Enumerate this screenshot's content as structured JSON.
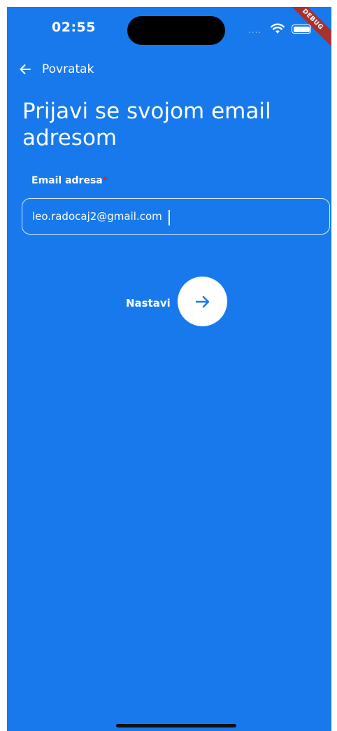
{
  "status_bar": {
    "time": "02:55",
    "signal": "....",
    "debug_banner": "DEBUG"
  },
  "header": {
    "back_label": "Povratak"
  },
  "main": {
    "title": "Prijavi se svojom email adresom",
    "email_label": "Email adresa",
    "required_mark": "*",
    "email_value": "leo.radocaj2@gmail.com",
    "continue_label": "Nastavi"
  },
  "colors": {
    "background": "#1779ec",
    "required": "#e0202a",
    "button_icon": "#1779ec"
  },
  "icons": {
    "back": "arrow-left-icon",
    "continue": "arrow-right-icon",
    "wifi": "wifi-icon",
    "battery": "battery-icon"
  }
}
